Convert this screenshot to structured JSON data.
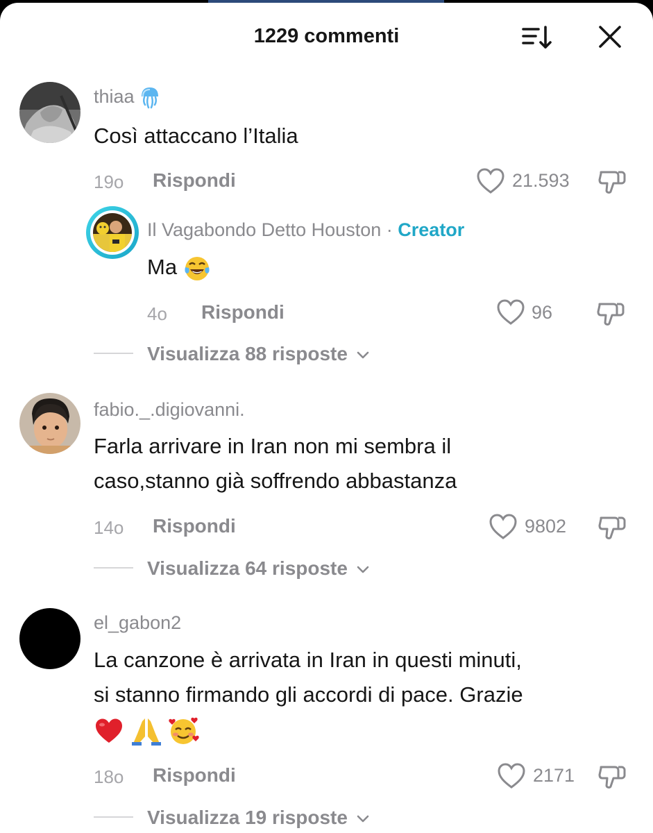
{
  "header": {
    "title": "1229 commenti",
    "sort_icon": "sort-descending-icon",
    "close_icon": "close-icon"
  },
  "colors": {
    "creator_accent": "#20a7c7",
    "muted_text": "#8a8a8e",
    "timestamp_text": "#a6a6aa",
    "heart_red": "#e0202b"
  },
  "comments": [
    {
      "username": "thiaa",
      "username_emoji": "jellyfish-emoji",
      "text_lines": [
        "Così attaccano l’Italia"
      ],
      "time": "19o",
      "reply_label": "Rispondi",
      "likes": "21.593",
      "reply": {
        "username": "Il Vagabondo Detto Houston",
        "separator": "·",
        "badge": "Creator",
        "text": "Ma",
        "text_emoji": "laughing-tears-emoji",
        "time": "4o",
        "reply_label": "Rispondi",
        "likes": "96"
      },
      "view_replies": "Visualizza 88 risposte"
    },
    {
      "username": "fabio._.digiovanni.",
      "text_lines": [
        "Farla arrivare in Iran non mi sembra il",
        "caso,stanno già soffrendo abbastanza"
      ],
      "time": "14o",
      "reply_label": "Rispondi",
      "likes": "9802",
      "view_replies": "Visualizza 64 risposte"
    },
    {
      "username": "el_gabon2",
      "text_lines": [
        "La canzone è arrivata in Iran in questi minuti,",
        "si stanno firmando gli accordi di pace. Grazie"
      ],
      "text_emojis": [
        "red-heart-emoji",
        "folded-hands-emoji",
        "smiling-hearts-emoji"
      ],
      "time": "18o",
      "reply_label": "Rispondi",
      "likes": "2171",
      "view_replies": "Visualizza 19 risposte"
    }
  ]
}
